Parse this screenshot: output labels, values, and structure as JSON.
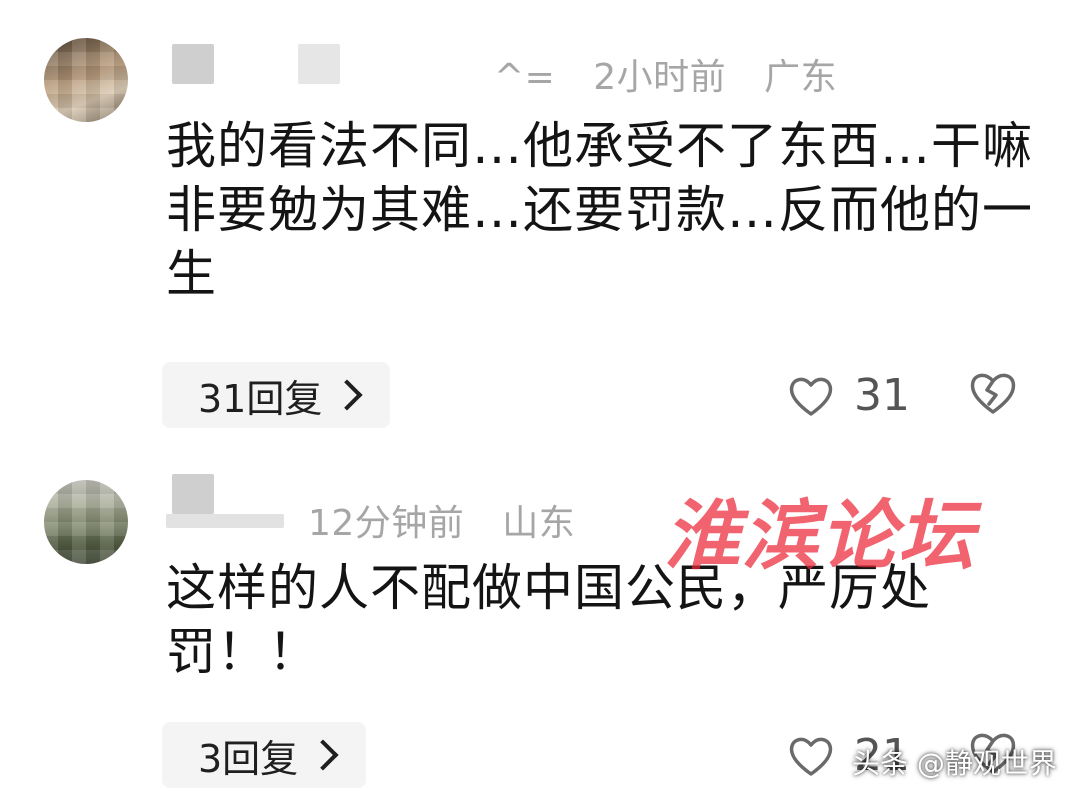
{
  "comments": [
    {
      "meta_tail": "^=",
      "time": "2小时前",
      "location": "广东",
      "text": "我的看法不同…他承受不了东西…干嘛非要勉为其难…还要罚款…反而他的一生",
      "reply_label": "31回复",
      "like_count": "31"
    },
    {
      "time": "12分钟前",
      "location": "山东",
      "text": "这样的人不配做中国公民，严厉处罚！！",
      "reply_label": "3回复",
      "like_count": "21"
    }
  ],
  "watermark": "淮滨论坛",
  "credit": "头条 @静观世界",
  "icons": {
    "like": "heart-outline-icon",
    "dislike": "broken-heart-icon",
    "reply": "chevron-right-icon"
  },
  "colors": {
    "meta_text": "#a6a6a6",
    "reply_bg": "#f4f4f4",
    "watermark": "#eb2837"
  }
}
